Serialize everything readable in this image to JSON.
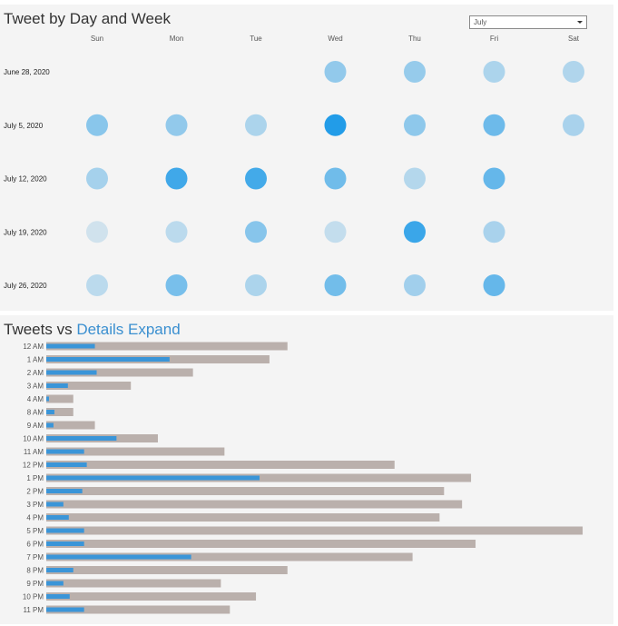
{
  "panels": {
    "calendar": {
      "title": "Tweet by Day and Week",
      "filter_value": "July"
    },
    "tweets": {
      "title_prefix": "Tweets vs",
      "title_link": "Details Expand"
    }
  },
  "colors": {
    "panel_bg": "#f4f4f4",
    "bar_total": "#bab0ac",
    "bar_details": "#3a95d8",
    "dot_base": "#1e9be8"
  },
  "chart_data": [
    {
      "type": "heatmap",
      "title": "Tweet by Day and Week",
      "days": [
        "Sun",
        "Mon",
        "Tue",
        "Wed",
        "Thu",
        "Fri",
        "Sat"
      ],
      "weeks": [
        "June 28, 2020",
        "July 5, 2020",
        "July 12, 2020",
        "July 19, 2020",
        "July 26, 2020"
      ],
      "values": [
        [
          null,
          null,
          null,
          0.38,
          0.36,
          0.24,
          0.22
        ],
        [
          0.43,
          0.38,
          0.24,
          0.98,
          0.4,
          0.58,
          0.26
        ],
        [
          0.28,
          0.82,
          0.8,
          0.56,
          0.2,
          0.62,
          null
        ],
        [
          0.05,
          0.16,
          0.44,
          0.12,
          0.85,
          0.26,
          null
        ],
        [
          0.16,
          0.52,
          0.24,
          0.55,
          0.3,
          0.62,
          null
        ]
      ]
    },
    {
      "type": "bar",
      "title": "Tweets vs Details Expand",
      "orientation": "horizontal",
      "categories": [
        "12 AM",
        "1 AM",
        "2 AM",
        "3 AM",
        "4 AM",
        "8 AM",
        "9 AM",
        "10 AM",
        "11 AM",
        "12 PM",
        "1 PM",
        "2 PM",
        "3 PM",
        "4 PM",
        "5 PM",
        "6 PM",
        "7 PM",
        "8 PM",
        "9 PM",
        "10 PM",
        "11 PM"
      ],
      "series": [
        {
          "name": "Tweets",
          "values": [
            268,
            248,
            163,
            94,
            30,
            30,
            54,
            124,
            198,
            387,
            472,
            442,
            462,
            437,
            596,
            477,
            407,
            268,
            194,
            233,
            204
          ]
        },
        {
          "name": "Details Expand",
          "values": [
            54,
            137,
            56,
            24,
            3,
            9,
            8,
            78,
            42,
            45,
            237,
            40,
            19,
            25,
            42,
            42,
            161,
            30,
            19,
            26,
            42
          ]
        }
      ],
      "xlim": [
        0,
        600
      ]
    }
  ]
}
